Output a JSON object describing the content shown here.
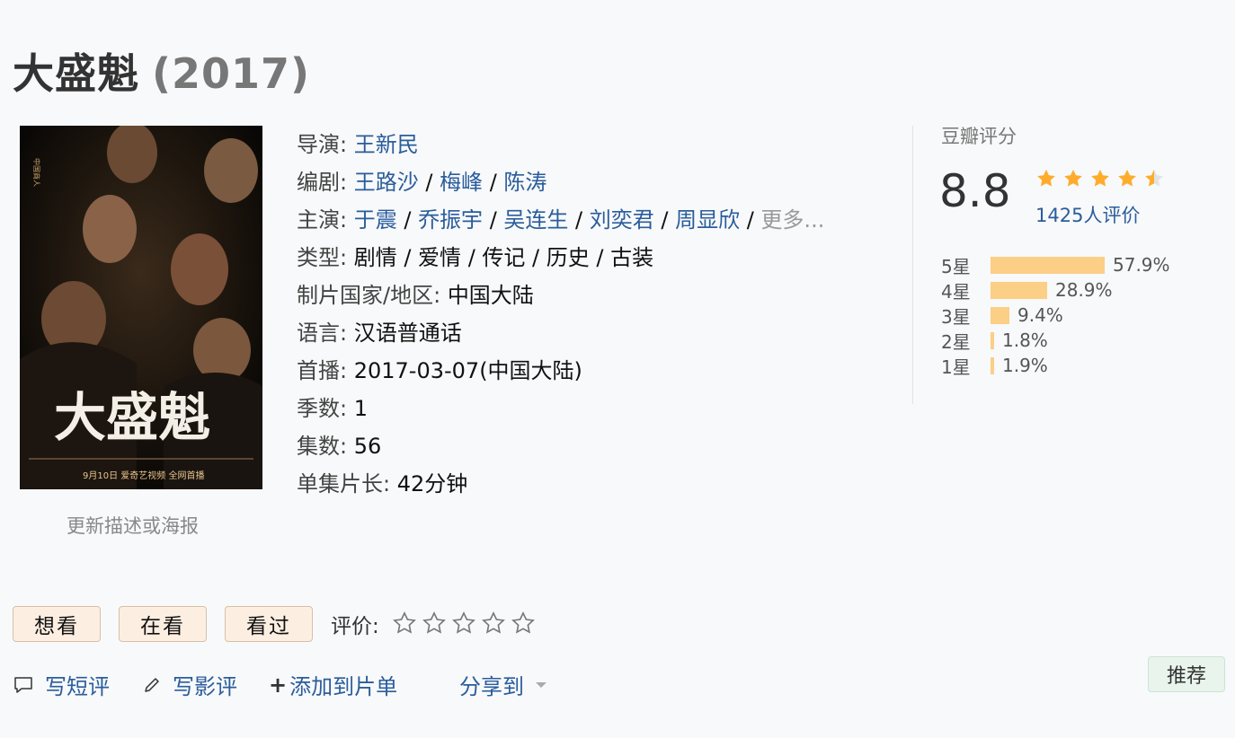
{
  "title": "大盛魁",
  "year": "(2017)",
  "poster": {
    "title_text": "大盛魁",
    "bottom_text": "9月10日 爱奇艺视频 全网首播"
  },
  "update_link": "更新描述或海报",
  "info": {
    "director": {
      "label": "导演",
      "names": [
        "王新民"
      ]
    },
    "writer": {
      "label": "编剧",
      "names": [
        "王路沙",
        "梅峰",
        "陈涛"
      ]
    },
    "cast": {
      "label": "主演",
      "names": [
        "于震",
        "乔振宇",
        "吴连生",
        "刘奕君",
        "周显欣"
      ],
      "more": "更多..."
    },
    "genre": {
      "label": "类型",
      "value": "剧情 / 爱情 / 传记 / 历史 / 古装"
    },
    "country": {
      "label": "制片国家/地区",
      "value": "中国大陆"
    },
    "language": {
      "label": "语言",
      "value": "汉语普通话"
    },
    "premiere": {
      "label": "首播",
      "value": "2017-03-07(中国大陆)"
    },
    "seasons": {
      "label": "季数",
      "value": "1"
    },
    "episodes": {
      "label": "集数",
      "value": "56"
    },
    "runtime": {
      "label": "单集片长",
      "value": "42分钟"
    }
  },
  "rating": {
    "title": "豆瓣评分",
    "score": "8.8",
    "stars_value": 4.5,
    "count_text": "1425人评价",
    "bar_color": "#fbcf86",
    "star_color": "#ffac2d",
    "distribution": [
      {
        "label": "5星",
        "percent": 57.9,
        "text": "57.9%"
      },
      {
        "label": "4星",
        "percent": 28.9,
        "text": "28.9%"
      },
      {
        "label": "3星",
        "percent": 9.4,
        "text": "9.4%"
      },
      {
        "label": "2星",
        "percent": 1.8,
        "text": "1.8%"
      },
      {
        "label": "1星",
        "percent": 1.9,
        "text": "1.9%"
      }
    ]
  },
  "actions": {
    "want": "想看",
    "watching": "在看",
    "watched": "看过",
    "rate_label": "评价:"
  },
  "bottom": {
    "short_review": "写短评",
    "review": "写影评",
    "add_list": "添加到片单",
    "share": "分享到",
    "recommend": "推荐"
  }
}
